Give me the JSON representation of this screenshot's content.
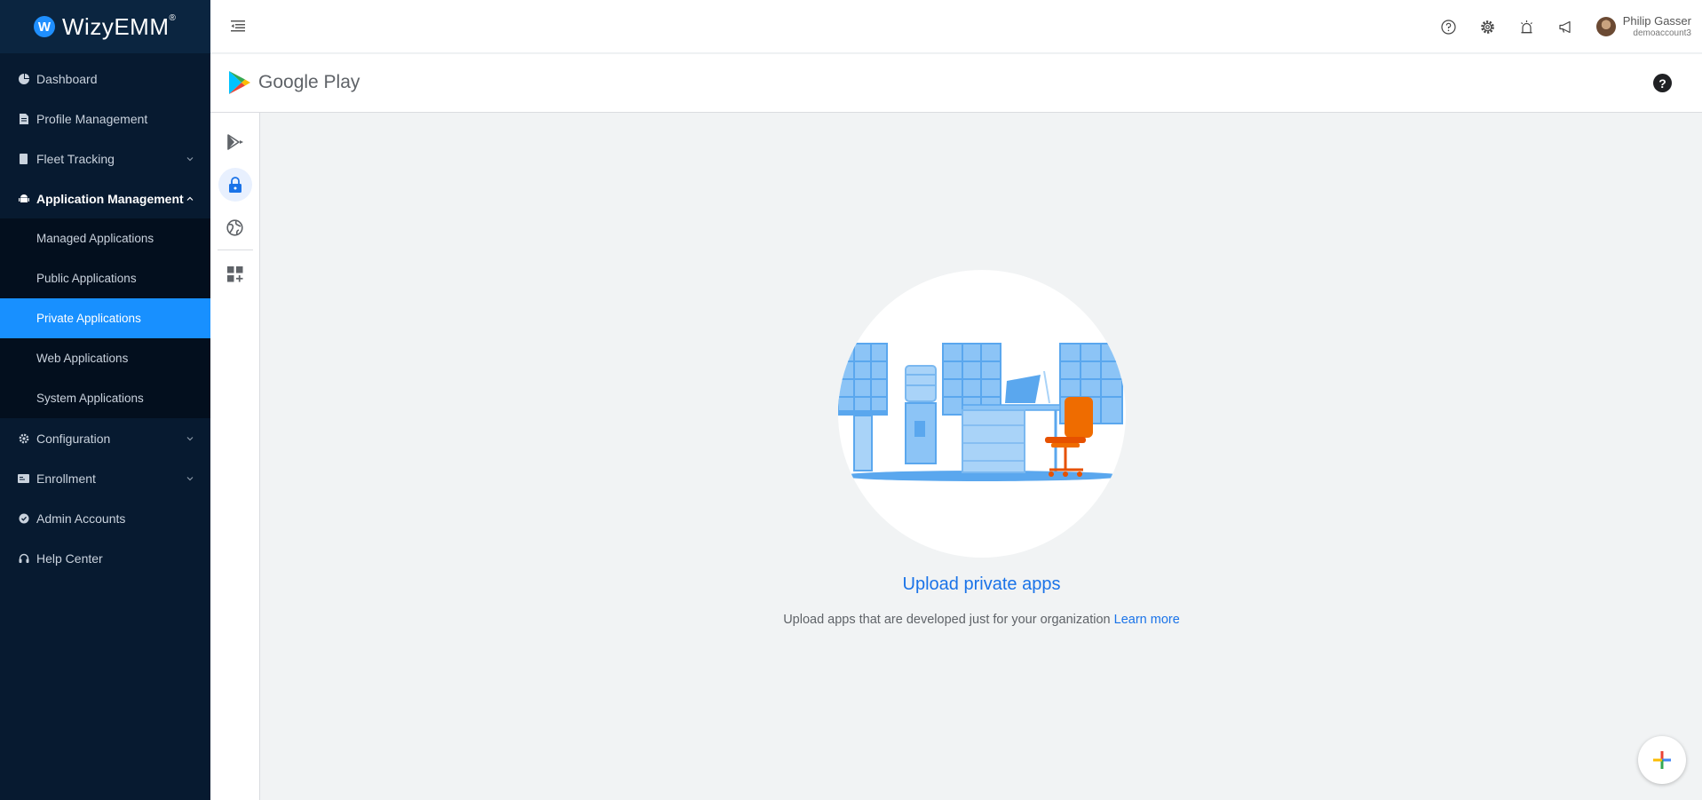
{
  "brand": {
    "name": "WizyEMM",
    "tm": "®",
    "badge": "W"
  },
  "sidebar": {
    "items": [
      {
        "label": "Dashboard",
        "icon": "pie-chart-icon"
      },
      {
        "label": "Profile Management",
        "icon": "document-icon"
      },
      {
        "label": "Fleet Tracking",
        "icon": "device-icon",
        "expandable": true
      },
      {
        "label": "Application Management",
        "icon": "android-icon",
        "expanded": true
      },
      {
        "label": "Configuration",
        "icon": "gear-icon",
        "expandable": true
      },
      {
        "label": "Enrollment",
        "icon": "id-card-icon",
        "expandable": true
      },
      {
        "label": "Admin Accounts",
        "icon": "shield-icon"
      },
      {
        "label": "Help Center",
        "icon": "headset-icon"
      }
    ],
    "app_management_sub": [
      {
        "label": "Managed Applications"
      },
      {
        "label": "Public Applications"
      },
      {
        "label": "Private Applications",
        "active": true
      },
      {
        "label": "Web Applications"
      },
      {
        "label": "System Applications"
      }
    ]
  },
  "topbar": {
    "icons": [
      "question-circle-icon",
      "gear-icon",
      "alarm-icon",
      "megaphone-icon"
    ],
    "user": {
      "name": "Philip Gasser",
      "account": "demoaccount3"
    }
  },
  "google_play": {
    "title": "Google Play",
    "help": "?"
  },
  "rail": [
    "play-store-icon",
    "lock-icon",
    "globe-icon",
    "apps-add-icon"
  ],
  "empty_state": {
    "title": "Upload private apps",
    "description": "Upload apps that are developed just for your organization",
    "link": "Learn more"
  },
  "colors": {
    "sidebar_bg": "#071a30",
    "active": "#1890ff",
    "link": "#1a73e8"
  }
}
